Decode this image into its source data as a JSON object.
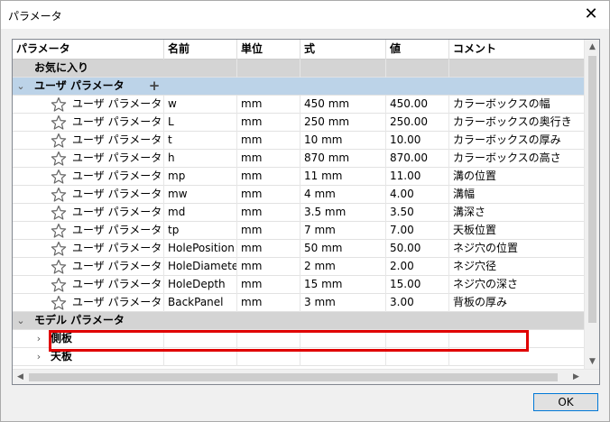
{
  "window": {
    "title": "パラメータ",
    "close_glyph": "✕"
  },
  "columns": [
    "パラメータ",
    "名前",
    "単位",
    "式",
    "値",
    "コメント"
  ],
  "groups": {
    "favorites": {
      "label": "お気に入り"
    },
    "user": {
      "label": "ユーザ パラメータ",
      "chevron": "⌄",
      "add": "+"
    },
    "model": {
      "label": "モデル パラメータ",
      "chevron": "⌄"
    }
  },
  "user_params": [
    {
      "type": "ユーザ パラメータ",
      "name": "w",
      "unit": "mm",
      "expr": "450 mm",
      "value": "450.00",
      "comment": "カラーボックスの幅"
    },
    {
      "type": "ユーザ パラメータ",
      "name": "L",
      "unit": "mm",
      "expr": "250 mm",
      "value": "250.00",
      "comment": "カラーボックスの奥行き"
    },
    {
      "type": "ユーザ パラメータ",
      "name": "t",
      "unit": "mm",
      "expr": "10 mm",
      "value": "10.00",
      "comment": "カラーボックスの厚み"
    },
    {
      "type": "ユーザ パラメータ",
      "name": "h",
      "unit": "mm",
      "expr": "870 mm",
      "value": "870.00",
      "comment": "カラーボックスの高さ"
    },
    {
      "type": "ユーザ パラメータ",
      "name": "mp",
      "unit": "mm",
      "expr": "11 mm",
      "value": "11.00",
      "comment": "溝の位置"
    },
    {
      "type": "ユーザ パラメータ",
      "name": "mw",
      "unit": "mm",
      "expr": "4 mm",
      "value": "4.00",
      "comment": "溝幅"
    },
    {
      "type": "ユーザ パラメータ",
      "name": "md",
      "unit": "mm",
      "expr": "3.5 mm",
      "value": "3.50",
      "comment": "溝深さ"
    },
    {
      "type": "ユーザ パラメータ",
      "name": "tp",
      "unit": "mm",
      "expr": "7 mm",
      "value": "7.00",
      "comment": "天板位置"
    },
    {
      "type": "ユーザ パラメータ",
      "name": "HolePosition",
      "unit": "mm",
      "expr": "50 mm",
      "value": "50.00",
      "comment": "ネジ穴の位置"
    },
    {
      "type": "ユーザ パラメータ",
      "name": "HoleDiameter",
      "unit": "mm",
      "expr": "2 mm",
      "value": "2.00",
      "comment": "ネジ穴径"
    },
    {
      "type": "ユーザ パラメータ",
      "name": "HoleDepth",
      "unit": "mm",
      "expr": "15 mm",
      "value": "15.00",
      "comment": "ネジ穴の深さ"
    },
    {
      "type": "ユーザ パラメータ",
      "name": "BackPanel",
      "unit": "mm",
      "expr": "3 mm",
      "value": "3.00",
      "comment": "背板の厚み"
    }
  ],
  "model_items": [
    {
      "label": "側板",
      "chevron": "›"
    },
    {
      "label": "天板",
      "chevron": "›"
    }
  ],
  "buttons": {
    "ok": "OK"
  },
  "icons": {
    "star": "star-outline-icon",
    "close": "close-icon"
  }
}
